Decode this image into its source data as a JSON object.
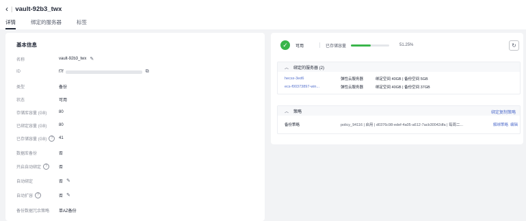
{
  "header": {
    "title": "vault-92b3_twx",
    "tabs": [
      {
        "label": "详情",
        "active": true
      },
      {
        "label": "绑定的服务器",
        "active": false
      },
      {
        "label": "标签",
        "active": false
      }
    ]
  },
  "basic_info": {
    "title": "基本信息",
    "rows": [
      {
        "key": "名称",
        "value": "vault-92b3_twx"
      },
      {
        "key": "ID",
        "value": "f7f"
      },
      {
        "key": "类型",
        "value": "备份"
      },
      {
        "key": "状态",
        "value": "可用"
      },
      {
        "key": "存储库容量 (GB)",
        "value": "80"
      },
      {
        "key": "已绑定容量 (GB)",
        "value": "80"
      },
      {
        "key": "已存储容量 (GB)",
        "value": "41"
      },
      {
        "key": "数据库备份",
        "value": "否"
      },
      {
        "key": "开启自动绑定",
        "value": "否"
      },
      {
        "key": "自动绑定",
        "value": "否"
      },
      {
        "key": "自动扩容",
        "value": "否"
      },
      {
        "key": "备份数据冗余策略",
        "value": "单AZ备份"
      }
    ]
  },
  "status": {
    "state": "可用",
    "capacity_label": "已存储容量",
    "percent_text": "51.25%",
    "percent_value": 51.25,
    "accent": "#39b54a"
  },
  "servers": {
    "title": "绑定的服务器 (2)",
    "rows": [
      {
        "name": "hecsx-3ed6",
        "type": "弹性云服务器",
        "info": "绑定空间 40GB | 备份空间 5GB"
      },
      {
        "name": "ecs-f00373897-win...",
        "type": "弹性云服务器",
        "info": "绑定空间 40GB | 备份空间 37GB"
      }
    ]
  },
  "policy": {
    "title": "策略",
    "link": "绑定复制策略",
    "row": {
      "name": "备份策略",
      "desc": "policy_94116 | 启用 | d0376c98-edef-4a05-a612-7acb30042dfa | 每周二...",
      "action1": "解绑策略",
      "action2": "编辑"
    }
  }
}
